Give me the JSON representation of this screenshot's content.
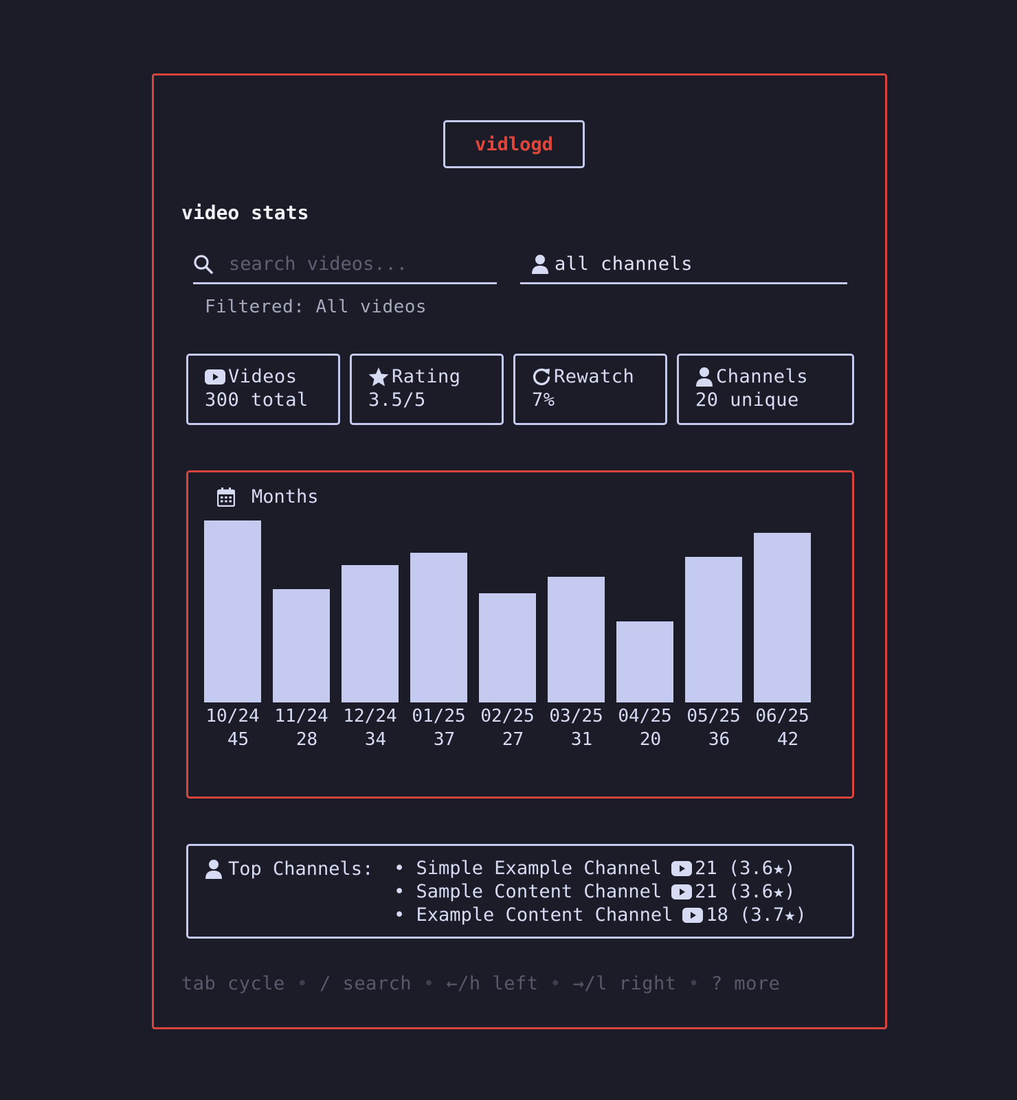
{
  "app": {
    "title": "vidlogd"
  },
  "section": {
    "title": "video stats"
  },
  "search": {
    "placeholder": "search videos...",
    "value": ""
  },
  "channel_filter": {
    "label": "all channels"
  },
  "filter_status": "Filtered: All videos",
  "stats": [
    {
      "icon": "video-icon",
      "label": "Videos",
      "value": "300 total"
    },
    {
      "icon": "star-icon",
      "label": "Rating",
      "value": "3.5/5"
    },
    {
      "icon": "refresh-icon",
      "label": "Rewatch",
      "value": "7%"
    },
    {
      "icon": "user-icon",
      "label": "Channels",
      "value": "20 unique"
    }
  ],
  "chart_data": {
    "type": "bar",
    "title": "Months",
    "categories": [
      "10/24",
      "11/24",
      "12/24",
      "01/25",
      "02/25",
      "03/25",
      "04/25",
      "05/25",
      "06/25"
    ],
    "values": [
      45,
      28,
      34,
      37,
      27,
      31,
      20,
      36,
      42
    ],
    "value_labels": [
      "45",
      "28",
      "34",
      "37",
      "27",
      "31",
      "20",
      "36",
      "42"
    ]
  },
  "top_channels": {
    "label": "Top Channels:",
    "items": [
      {
        "bullet": "•",
        "name": "Simple Example Channel",
        "count": "21",
        "rating": "(3.6★)"
      },
      {
        "bullet": "•",
        "name": "Sample Content Channel",
        "count": "21",
        "rating": "(3.6★)"
      },
      {
        "bullet": "•",
        "name": "Example Content Channel",
        "count": "18",
        "rating": "(3.7★)"
      }
    ]
  },
  "footer": {
    "hints": [
      "tab cycle",
      "/ search",
      "←/h left",
      "→/l right",
      "? more"
    ],
    "separator": "•"
  },
  "colors": {
    "background": "#1b1c27",
    "accent_red": "#d9443c",
    "border": "#c5cbef",
    "bar": "#c4caf0"
  }
}
